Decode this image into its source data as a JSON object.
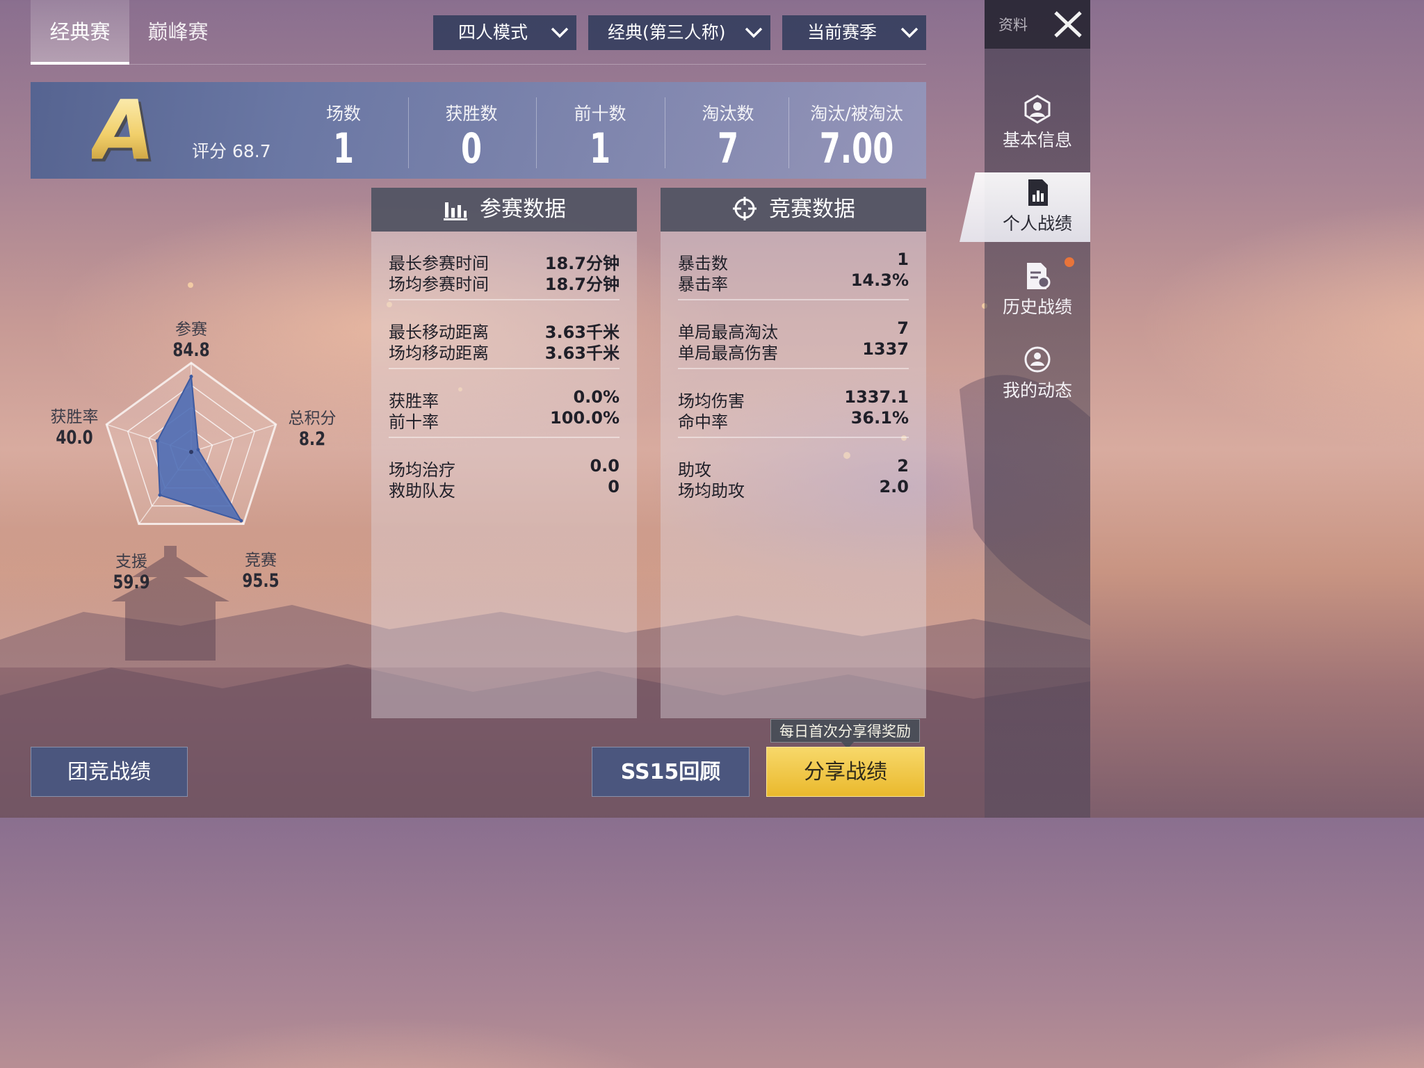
{
  "tabs": [
    {
      "label": "经典赛",
      "active": true
    },
    {
      "label": "巅峰赛",
      "active": false
    }
  ],
  "filters": {
    "mode": "四人模式",
    "perspective": "经典(第三人称)",
    "season": "当前赛季"
  },
  "summary": {
    "grade": "A",
    "score_label": "评分 68.7",
    "stats": [
      {
        "label": "场数",
        "value": "1"
      },
      {
        "label": "获胜数",
        "value": "0"
      },
      {
        "label": "前十数",
        "value": "1"
      },
      {
        "label": "淘汰数",
        "value": "7"
      },
      {
        "label": "淘汰/被淘汰",
        "value": "7.00"
      }
    ]
  },
  "radar": {
    "axes": [
      {
        "name": "参赛",
        "score": "84.8",
        "value": 84.8
      },
      {
        "name": "总积分",
        "score": "8.2",
        "value": 8.2
      },
      {
        "name": "竞赛",
        "score": "95.5",
        "value": 95.5
      },
      {
        "name": "支援",
        "score": "59.9",
        "value": 59.9
      },
      {
        "name": "获胜率",
        "score": "40.0",
        "value": 40.0
      }
    ],
    "max": 100,
    "fill_color": "#4a6bb5"
  },
  "participation_panel": {
    "title": "参赛数据",
    "icon": "bar-chart-icon",
    "groups": [
      {
        "rows": [
          {
            "k": "最长参赛时间",
            "v": "18.7分钟"
          },
          {
            "k": "场均参赛时间",
            "v": "18.7分钟"
          }
        ]
      },
      {
        "rows": [
          {
            "k": "最长移动距离",
            "v": "3.63千米"
          },
          {
            "k": "场均移动距离",
            "v": "3.63千米"
          }
        ]
      },
      {
        "rows": [
          {
            "k": "获胜率",
            "v": "0.0%"
          },
          {
            "k": "前十率",
            "v": "100.0%"
          }
        ]
      },
      {
        "rows": [
          {
            "k": "场均治疗",
            "v": "0.0"
          },
          {
            "k": "救助队友",
            "v": "0"
          }
        ]
      }
    ]
  },
  "combat_panel": {
    "title": "竞赛数据",
    "icon": "crosshair-icon",
    "groups": [
      {
        "rows": [
          {
            "k": "暴击数",
            "v": "1"
          },
          {
            "k": "暴击率",
            "v": "14.3%"
          }
        ]
      },
      {
        "rows": [
          {
            "k": "单局最高淘汰",
            "v": "7"
          },
          {
            "k": "单局最高伤害",
            "v": "1337"
          }
        ]
      },
      {
        "rows": [
          {
            "k": "场均伤害",
            "v": "1337.1"
          },
          {
            "k": "命中率",
            "v": "36.1%"
          }
        ]
      },
      {
        "rows": [
          {
            "k": "助攻",
            "v": "2"
          },
          {
            "k": "场均助攻",
            "v": "2.0"
          }
        ]
      }
    ]
  },
  "sidebar": {
    "header": "资料",
    "items": [
      {
        "label": "基本信息",
        "icon": "profile-icon"
      },
      {
        "label": "个人战绩",
        "icon": "stats-doc-icon",
        "active": true
      },
      {
        "label": "历史战绩",
        "icon": "history-doc-icon"
      },
      {
        "label": "我的动态",
        "icon": "activity-icon"
      }
    ]
  },
  "buttons": {
    "team": "团竞战绩",
    "review": "SS15回顾",
    "share": "分享战绩",
    "share_tip": "每日首次分享得奖励"
  }
}
